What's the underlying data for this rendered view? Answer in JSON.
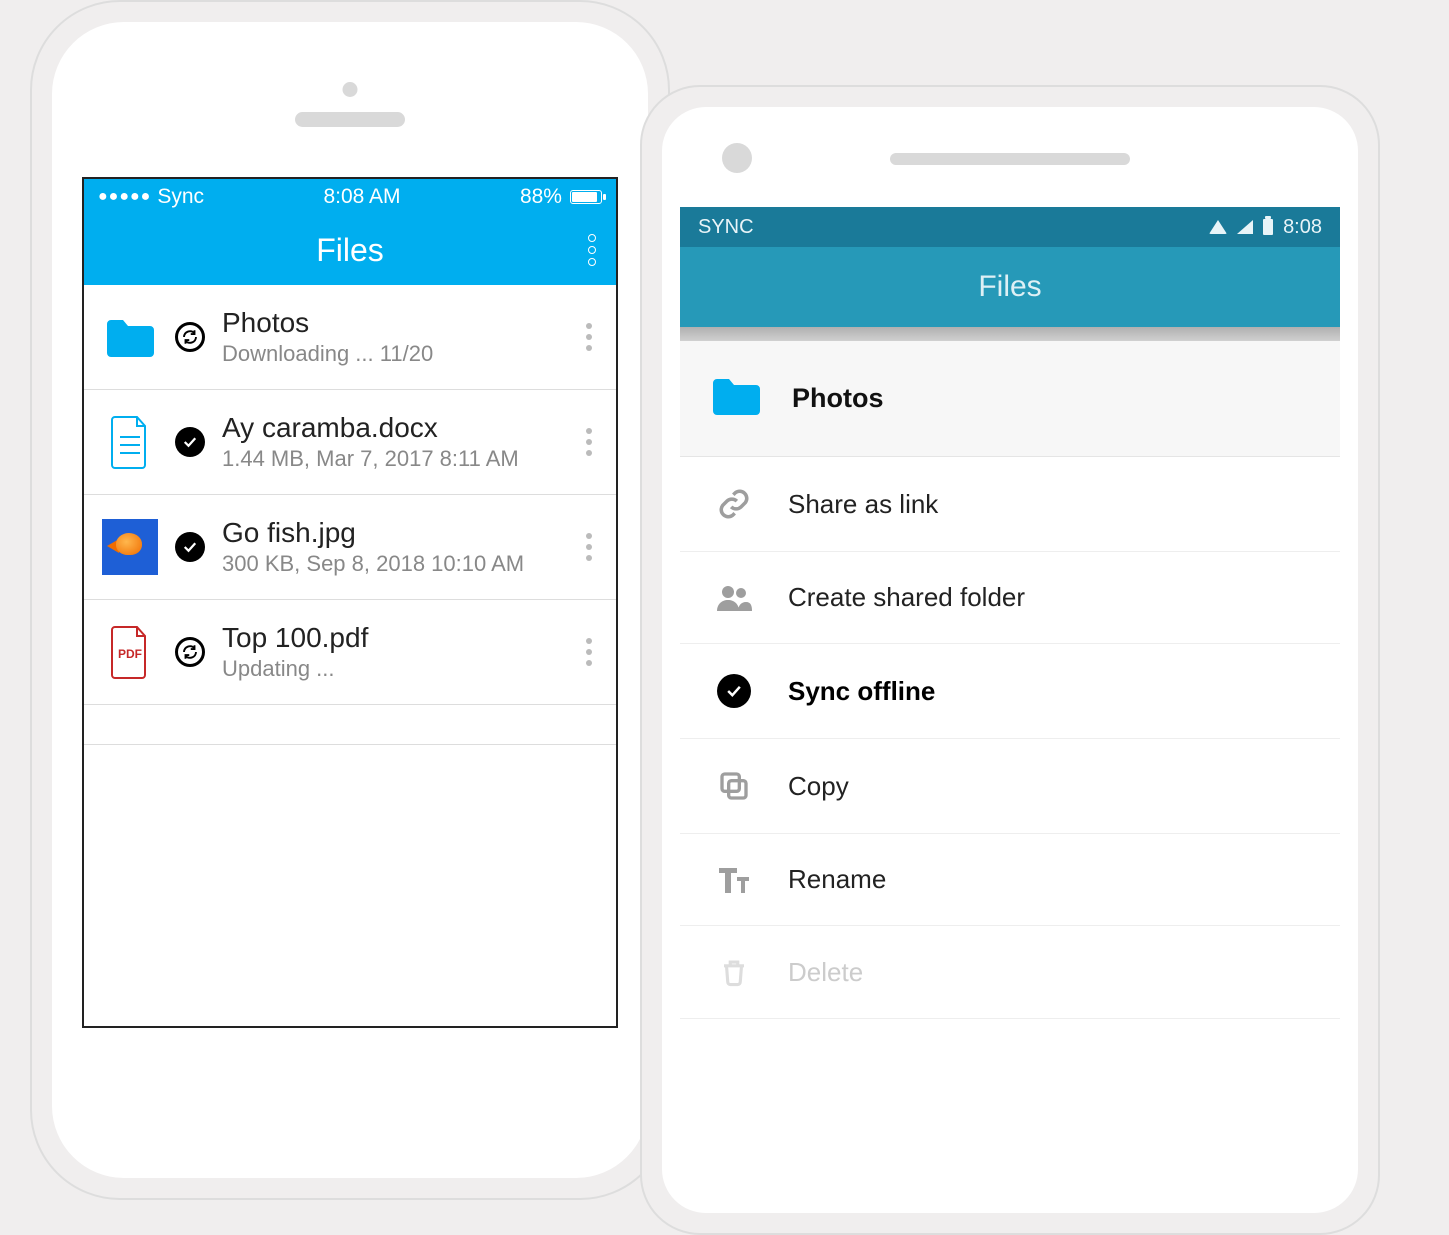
{
  "ios": {
    "status": {
      "carrier": "Sync",
      "time": "8:08  AM",
      "battery": "88%"
    },
    "nav_title": "Files",
    "items": [
      {
        "name": "Photos",
        "sub": "Downloading ... 11/20"
      },
      {
        "name": "Ay caramba.docx",
        "sub": "1.44 MB, Mar 7, 2017 8:11 AM"
      },
      {
        "name": "Go fish.jpg",
        "sub": "300 KB, Sep 8, 2018 10:10 AM"
      },
      {
        "name": "Top 100.pdf",
        "sub": "Updating ..."
      }
    ]
  },
  "android": {
    "status": {
      "carrier": "SYNC",
      "time": "8:08"
    },
    "nav_title": "Files",
    "folder_name": "Photos",
    "actions": [
      {
        "label": "Share as link"
      },
      {
        "label": "Create shared folder"
      },
      {
        "label": "Sync offline"
      },
      {
        "label": "Copy"
      },
      {
        "label": "Rename"
      },
      {
        "label": "Delete"
      }
    ]
  }
}
